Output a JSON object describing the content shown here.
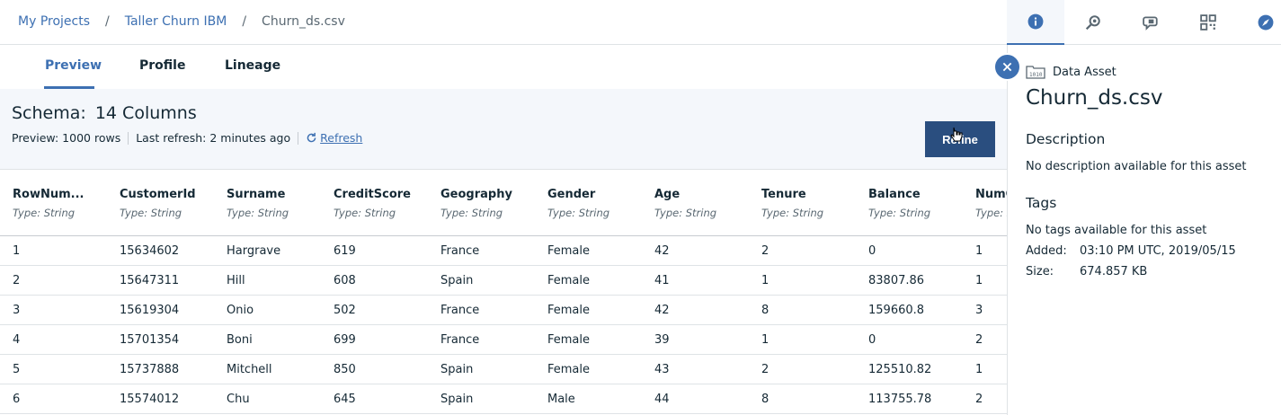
{
  "breadcrumb": {
    "items": [
      "My Projects",
      "Taller Churn IBM"
    ],
    "separator": "/",
    "current": "Churn_ds.csv"
  },
  "toolbar": {
    "icons": [
      "info-icon",
      "search-icon",
      "chat-icon",
      "qr-icon",
      "compass-icon"
    ],
    "active": "info-icon"
  },
  "tabs": [
    {
      "label": "Preview",
      "active": true
    },
    {
      "label": "Profile",
      "active": false
    },
    {
      "label": "Lineage",
      "active": false
    }
  ],
  "schema": {
    "label": "Schema:",
    "count": "14 Columns",
    "preview_label": "Preview:",
    "preview_value": "1000 rows",
    "refresh_label": "Last refresh:",
    "refresh_value": "2 minutes ago",
    "refresh_link": "Refresh",
    "refine_button": "Refine"
  },
  "table": {
    "columns": [
      {
        "name": "RowNum...",
        "type": "Type: String"
      },
      {
        "name": "CustomerId",
        "type": "Type: String"
      },
      {
        "name": "Surname",
        "type": "Type: String"
      },
      {
        "name": "CreditScore",
        "type": "Type: String"
      },
      {
        "name": "Geography",
        "type": "Type: String"
      },
      {
        "name": "Gender",
        "type": "Type: String"
      },
      {
        "name": "Age",
        "type": "Type: String"
      },
      {
        "name": "Tenure",
        "type": "Type: String"
      },
      {
        "name": "Balance",
        "type": "Type: String"
      },
      {
        "name": "NumO",
        "type": "Type: S"
      }
    ],
    "rows": [
      [
        "1",
        "15634602",
        "Hargrave",
        "619",
        "France",
        "Female",
        "42",
        "2",
        "0",
        "1"
      ],
      [
        "2",
        "15647311",
        "Hill",
        "608",
        "Spain",
        "Female",
        "41",
        "1",
        "83807.86",
        "1"
      ],
      [
        "3",
        "15619304",
        "Onio",
        "502",
        "France",
        "Female",
        "42",
        "8",
        "159660.8",
        "3"
      ],
      [
        "4",
        "15701354",
        "Boni",
        "699",
        "France",
        "Female",
        "39",
        "1",
        "0",
        "2"
      ],
      [
        "5",
        "15737888",
        "Mitchell",
        "850",
        "Spain",
        "Female",
        "43",
        "2",
        "125510.82",
        "1"
      ],
      [
        "6",
        "15574012",
        "Chu",
        "645",
        "Spain",
        "Male",
        "44",
        "8",
        "113755.78",
        "2"
      ]
    ]
  },
  "panel": {
    "asset_type": "Data Asset",
    "asset_name": "Churn_ds.csv",
    "description_title": "Description",
    "description_text": "No description available for this asset",
    "tags_title": "Tags",
    "tags_text": "No tags available for this asset",
    "added_label": "Added:",
    "added_value": "03:10 PM UTC, 2019/05/15",
    "size_label": "Size:",
    "size_value": "674.857 KB"
  },
  "colors": {
    "accent": "#3d70b2",
    "button": "#2a4e7f",
    "schema_bg": "#f4f7fb"
  }
}
